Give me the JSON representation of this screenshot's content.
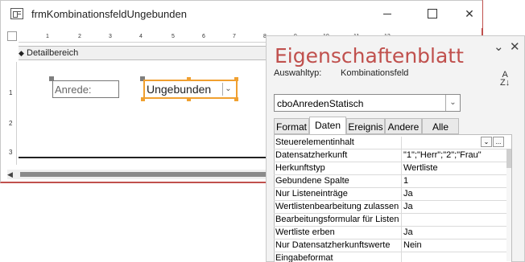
{
  "form_window": {
    "title": "frmKombinationsfeldUngebunden",
    "section_label": "Detailbereich",
    "ruler_marks": [
      "1",
      "2",
      "3",
      "4",
      "5",
      "6",
      "7",
      "8",
      "9",
      "10",
      "11",
      "12"
    ],
    "vruler_marks": [
      "1",
      "2",
      "3"
    ],
    "label_text": "Anrede:",
    "combo_text": "Ungebunden"
  },
  "property_sheet": {
    "title": "Eigenschaftenblatt",
    "selection_type_label": "Auswahltyp:",
    "selection_type_value": "Kombinationsfeld",
    "object_name": "cboAnredenStatisch",
    "tabs": [
      "Format",
      "Daten",
      "Ereignis",
      "Andere",
      "Alle"
    ],
    "active_tab": "Daten",
    "properties": [
      {
        "name": "Steuerelementinhalt",
        "value": ""
      },
      {
        "name": "Datensatzherkunft",
        "value": "\"1\";\"Herr\";\"2\";\"Frau\""
      },
      {
        "name": "Herkunftstyp",
        "value": "Wertliste"
      },
      {
        "name": "Gebundene Spalte",
        "value": "1"
      },
      {
        "name": "Nur Listeneinträge",
        "value": "Ja"
      },
      {
        "name": "Wertlistenbearbeitung zulassen",
        "value": "Ja"
      },
      {
        "name": "Bearbeitungsformular für Listen",
        "value": ""
      },
      {
        "name": "Wertliste erben",
        "value": "Ja"
      },
      {
        "name": "Nur Datensatzherkunftswerte",
        "value": "Nein"
      },
      {
        "name": "Eingabeformat",
        "value": ""
      }
    ],
    "row_button_builder": "...",
    "row_button_dropdown": "⌄"
  },
  "icons": {
    "window": "form-window-icon",
    "minimize": "minimize-icon",
    "maximize": "maximize-icon",
    "close": "close-icon",
    "pane_collapse": "chevron-down-icon",
    "pane_close": "close-icon",
    "sort": "sort-az-icon",
    "dropdown": "chevron-down-icon"
  },
  "colors": {
    "accent": "#c0504d",
    "selection_orange": "#f0a030"
  }
}
